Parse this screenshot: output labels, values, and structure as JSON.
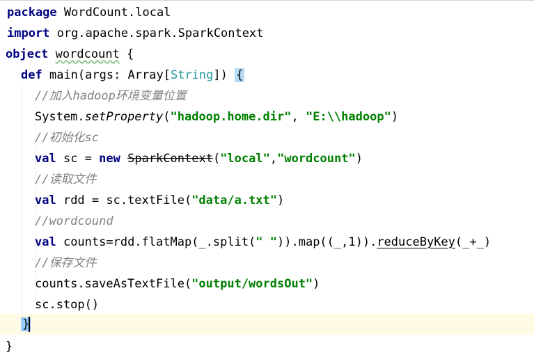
{
  "lines": [
    {
      "parts": [
        {
          "t": "package",
          "c": "kw"
        },
        {
          "t": " WordCount.local"
        }
      ]
    },
    {
      "parts": [
        {
          "t": "import",
          "c": "kw"
        },
        {
          "t": " org.apache.spark.SparkContext"
        }
      ]
    },
    {
      "parts": [
        {
          "t": "object",
          "c": "kw"
        },
        {
          "t": " "
        },
        {
          "t": "wordcount",
          "c": "typo"
        },
        {
          "t": " {"
        }
      ]
    },
    {
      "parts": [
        {
          "t": "def",
          "c": "kw"
        },
        {
          "t": " main(args: Array["
        },
        {
          "t": "String",
          "c": "type"
        },
        {
          "t": "]) "
        },
        {
          "t": "{",
          "c": "brace-hl"
        }
      ]
    },
    {
      "parts": [
        {
          "t": "//加入hadoop环境变量位置",
          "c": "cm"
        }
      ]
    },
    {
      "parts": [
        {
          "t": "System."
        },
        {
          "t": "setProperty",
          "c": "method-italic"
        },
        {
          "t": "("
        },
        {
          "t": "\"hadoop.home.dir\"",
          "c": "str"
        },
        {
          "t": ", "
        },
        {
          "t": "\"E:\\\\hadoop\"",
          "c": "str"
        },
        {
          "t": ")"
        }
      ]
    },
    {
      "parts": [
        {
          "t": "//初始化sc",
          "c": "cm"
        }
      ]
    },
    {
      "parts": [
        {
          "t": "val",
          "c": "kw"
        },
        {
          "t": " sc = "
        },
        {
          "t": "new",
          "c": "kw"
        },
        {
          "t": " "
        },
        {
          "t": "SparkContext",
          "c": "deprecated"
        },
        {
          "t": "("
        },
        {
          "t": "\"local\"",
          "c": "str"
        },
        {
          "t": ","
        },
        {
          "t": "\"wordcount\"",
          "c": "str"
        },
        {
          "t": ")"
        }
      ]
    },
    {
      "parts": [
        {
          "t": "//读取文件",
          "c": "cm"
        }
      ]
    },
    {
      "parts": [
        {
          "t": "val",
          "c": "kw"
        },
        {
          "t": " rdd = sc.textFile("
        },
        {
          "t": "\"data/a.txt\"",
          "c": "str"
        },
        {
          "t": ")"
        }
      ]
    },
    {
      "parts": [
        {
          "t": "//wordcound",
          "c": "cm"
        }
      ]
    },
    {
      "parts": [
        {
          "t": "val",
          "c": "kw"
        },
        {
          "t": " counts=rdd.flatMap(_.split("
        },
        {
          "t": "\" \"",
          "c": "str"
        },
        {
          "t": ")).map((_,1))."
        },
        {
          "t": "reduceByKey",
          "c": "underline"
        },
        {
          "t": "(_+_)"
        }
      ]
    },
    {
      "parts": [
        {
          "t": "//保存文件",
          "c": "cm"
        }
      ]
    },
    {
      "parts": [
        {
          "t": "counts.saveAsTextFile("
        },
        {
          "t": "\"output/wordsOut\"",
          "c": "str"
        },
        {
          "t": ")"
        }
      ]
    },
    {
      "parts": [
        {
          "t": "sc.stop()"
        }
      ]
    },
    {
      "parts": [
        {
          "t": "}",
          "c": "brace-hl-dark"
        }
      ]
    },
    {
      "parts": [
        {
          "t": "}"
        }
      ]
    }
  ]
}
